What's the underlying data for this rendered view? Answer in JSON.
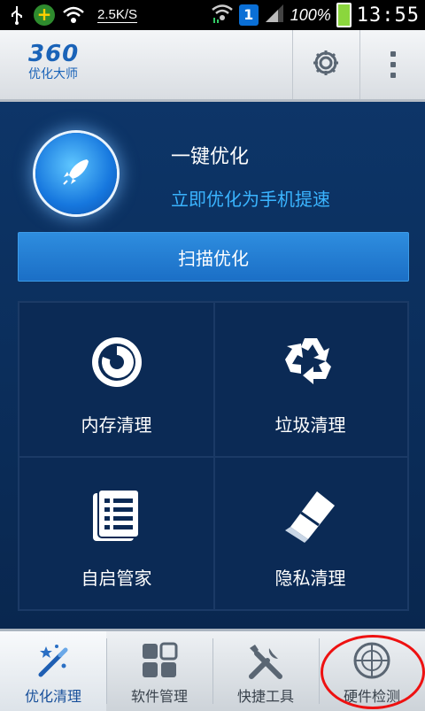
{
  "status_bar": {
    "net_speed": "2.5K/S",
    "sim_number": "1",
    "battery": "100%",
    "time": "13:55",
    "icons": [
      "usb-icon",
      "app-notification-icon",
      "wifi-icon",
      "signal-icon",
      "battery-icon"
    ]
  },
  "header": {
    "logo_number": "360",
    "logo_text": "优化大师",
    "icons": [
      "gear-icon",
      "more-icon"
    ]
  },
  "optimize": {
    "title": "一键优化",
    "subtitle": "立即优化为手机提速",
    "scan_button": "扫描优化",
    "icon": "rocket-icon"
  },
  "tiles": [
    {
      "label": "内存清理",
      "icon": "memory-icon"
    },
    {
      "label": "垃圾清理",
      "icon": "recycle-icon"
    },
    {
      "label": "自启管家",
      "icon": "list-icon"
    },
    {
      "label": "隐私清理",
      "icon": "eraser-icon"
    }
  ],
  "bottom_nav": [
    {
      "label": "优化清理",
      "icon": "magic-wand-icon",
      "active": true
    },
    {
      "label": "软件管理",
      "icon": "apps-icon",
      "active": false
    },
    {
      "label": "快捷工具",
      "icon": "tools-icon",
      "active": false
    },
    {
      "label": "硬件检测",
      "icon": "radar-icon",
      "active": false
    }
  ],
  "colors": {
    "accent": "#1b6fc6",
    "subtitle": "#3ab4ff",
    "background": "#0a2b57",
    "annotation_circle": "#ee1111"
  }
}
